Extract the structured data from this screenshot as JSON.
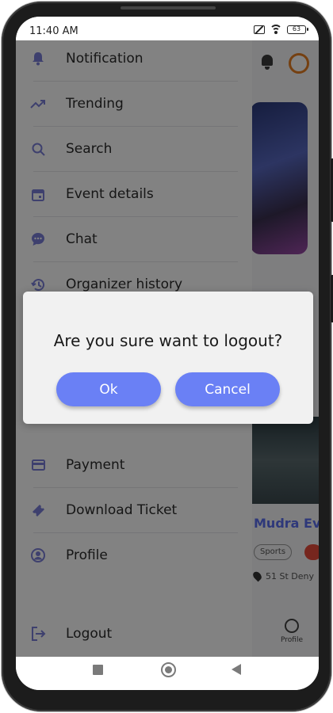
{
  "status_bar": {
    "time": "11:40 AM",
    "battery": "63"
  },
  "drawer": {
    "items": [
      {
        "label": "Notification",
        "icon": "bell-icon"
      },
      {
        "label": "Trending",
        "icon": "trending-icon"
      },
      {
        "label": "Search",
        "icon": "search-icon"
      },
      {
        "label": "Event details",
        "icon": "calendar-icon"
      },
      {
        "label": "Chat",
        "icon": "chat-icon"
      },
      {
        "label": "Organizer history",
        "icon": "history-icon"
      },
      {
        "label": "Payment",
        "icon": "card-icon"
      },
      {
        "label": "Download Ticket",
        "icon": "ticket-icon"
      },
      {
        "label": "Profile",
        "icon": "user-icon"
      }
    ],
    "logout": {
      "label": "Logout",
      "icon": "logout-icon"
    }
  },
  "main": {
    "event_title": "Mudra Ev",
    "event_tag": "Sports",
    "event_location": "51 St Deny",
    "tab_profile": "Profile"
  },
  "dialog": {
    "message": "Are you sure want to logout?",
    "ok_label": "Ok",
    "cancel_label": "Cancel"
  },
  "colors": {
    "accent": "#6a80f5",
    "scrim": "rgba(0,0,0,0.49)",
    "drawer_icon": "#7a7fd8"
  }
}
